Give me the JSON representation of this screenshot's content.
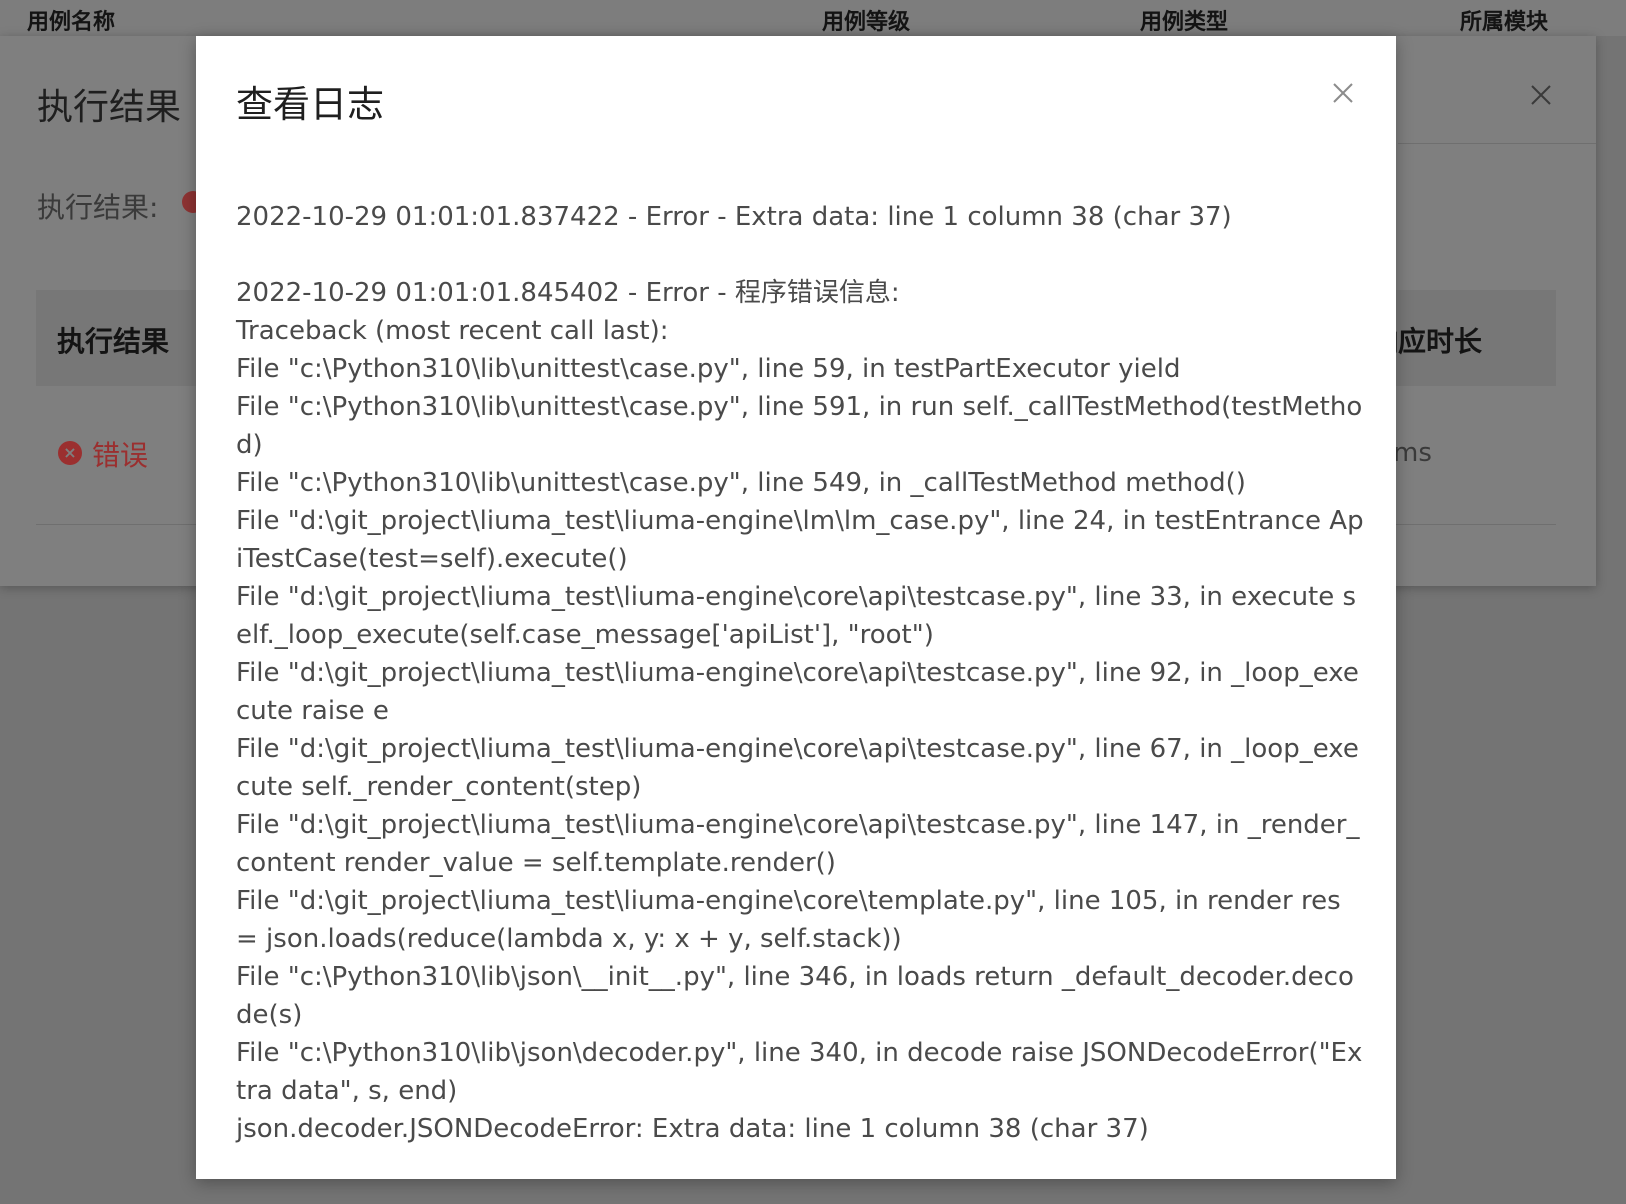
{
  "background_table": {
    "columns": [
      "用例名称",
      "用例等级",
      "用例类型",
      "所属模块"
    ]
  },
  "outer_dialog": {
    "title": "执行结果",
    "result_label": "执行结果:",
    "table_head_first": "执行结果",
    "table_head_last": "响应时长",
    "row_status": "错误",
    "row_duration": "ms"
  },
  "log_modal": {
    "title": "查看日志",
    "entry1": "2022-10-29 01:01:01.837422 - Error - Extra data: line 1 column 38 (char 37)",
    "entry2_lines": [
      "2022-10-29 01:01:01.845402 - Error - 程序错误信息:",
      "Traceback (most recent call last):",
      "File \"c:\\Python310\\lib\\unittest\\case.py\", line 59, in testPartExecutor yield",
      "File \"c:\\Python310\\lib\\unittest\\case.py\", line 591, in run self._callTestMethod(testMethod)",
      "File \"c:\\Python310\\lib\\unittest\\case.py\", line 549, in _callTestMethod method()",
      "File \"d:\\git_project\\liuma_test\\liuma-engine\\lm\\lm_case.py\", line 24, in testEntrance ApiTestCase(test=self).execute()",
      "File \"d:\\git_project\\liuma_test\\liuma-engine\\core\\api\\testcase.py\", line 33, in execute self._loop_execute(self.case_message['apiList'], \"root\")",
      "File \"d:\\git_project\\liuma_test\\liuma-engine\\core\\api\\testcase.py\", line 92, in _loop_execute raise e",
      "File \"d:\\git_project\\liuma_test\\liuma-engine\\core\\api\\testcase.py\", line 67, in _loop_execute self._render_content(step)",
      "File \"d:\\git_project\\liuma_test\\liuma-engine\\core\\api\\testcase.py\", line 147, in _render_content render_value = self.template.render()",
      "File \"d:\\git_project\\liuma_test\\liuma-engine\\core\\template.py\", line 105, in render res = json.loads(reduce(lambda x, y: x + y, self.stack))",
      "File \"c:\\Python310\\lib\\json\\__init__.py\", line 346, in loads return _default_decoder.decode(s)",
      "File \"c:\\Python310\\lib\\json\\decoder.py\", line 340, in decode raise JSONDecodeError(\"Extra data\", s, end)",
      "json.decoder.JSONDecodeError: Extra data: line 1 column 38 (char 37)"
    ]
  }
}
